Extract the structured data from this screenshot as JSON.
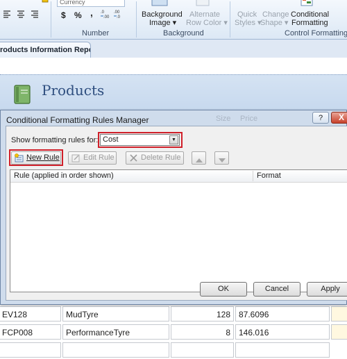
{
  "ribbon": {
    "font_box_text": "Currency",
    "currency_symbol": "$",
    "percent_symbol": "%",
    "decimal_inc": ".0→.00",
    "decimal_dec": ".00→.0",
    "number_label": "Number",
    "background_image_l1": "Background",
    "background_image_l2": "Image ▾",
    "alternate_row_l1": "Alternate",
    "alternate_row_l2": "Row Color ▾",
    "background_label": "Background",
    "quick_styles_l1": "Quick",
    "quick_styles_l2": "Styles ▾",
    "change_shape_l1": "Change",
    "change_shape_l2": "Shape ▾",
    "conditional_l1": "Conditional",
    "conditional_l2": "Formatting",
    "control_formatting_label": "Control Formatting"
  },
  "document": {
    "tab_label": "roducts Information Report",
    "report_title": "Products"
  },
  "dialog": {
    "title": "Conditional Formatting Rules Manager",
    "ghost_left": "Size",
    "ghost_right": "Price",
    "help_label": "?",
    "close_label": "X",
    "show_rules_label": "Show formatting rules for:",
    "combo_value": "Cost",
    "new_rule_label": "New Rule",
    "edit_rule_label": "Edit Rule",
    "delete_rule_label": "Delete Rule",
    "col_rule_header": "Rule (applied in order shown)",
    "col_format_header": "Format",
    "ok_label": "OK",
    "cancel_label": "Cancel",
    "apply_label": "Apply"
  },
  "table_rows": [
    {
      "id": "EV128",
      "name": "MudTyre",
      "qty": "128",
      "cost": "87.6096"
    },
    {
      "id": "FCP008",
      "name": "PerformanceTyre",
      "qty": "8",
      "cost": "146.016"
    }
  ],
  "colors": {
    "highlight": "#d0202a",
    "ribbon_bg": "#dce8f5",
    "report_title": "#2e4e7f"
  }
}
